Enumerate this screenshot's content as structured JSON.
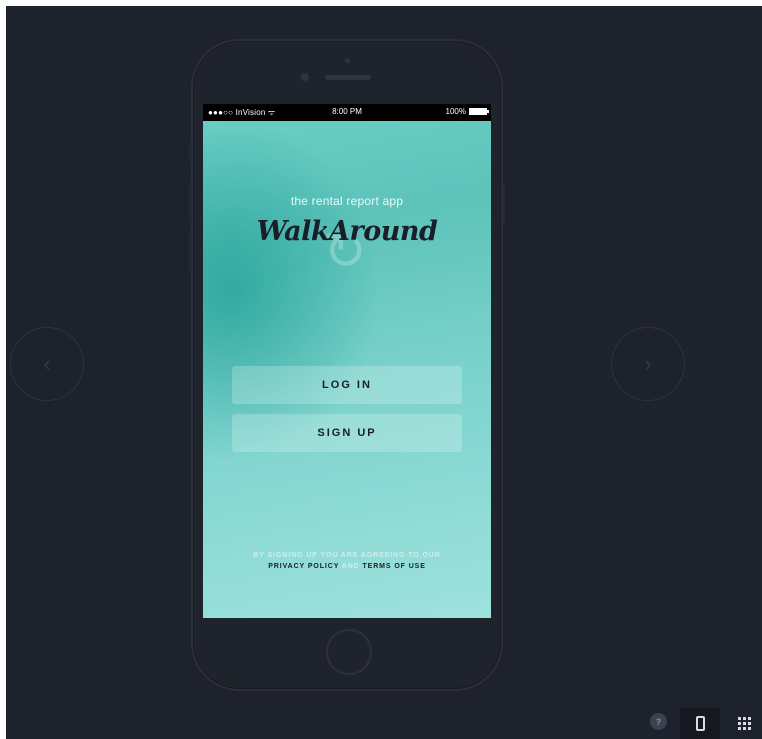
{
  "status_bar": {
    "carrier": "●●●○○ InVision ᯤ",
    "time": "8:00 PM",
    "battery": "100%"
  },
  "screen": {
    "tagline": "the rental report app",
    "logo": "WalkAround",
    "login_label": "LOG IN",
    "signup_label": "SIGN UP",
    "legal_line1": "BY SIGNING UP YOU ARE AGREEING TO OUR",
    "privacy_policy": "PRIVACY POLICY",
    "and": "AND",
    "terms_of_use": "TERMS OF USE"
  },
  "navigation": {
    "prev_icon": "chevron-left-icon",
    "next_icon": "chevron-right-icon"
  },
  "toolbar": {
    "help_label": "?",
    "device_icon": "phone-outline-icon",
    "grid_icon": "grid-icon"
  },
  "colors": {
    "stage_bg": "#1e222c",
    "screen_teal": "#6ccfc6",
    "text_dark": "#1a1e28"
  }
}
